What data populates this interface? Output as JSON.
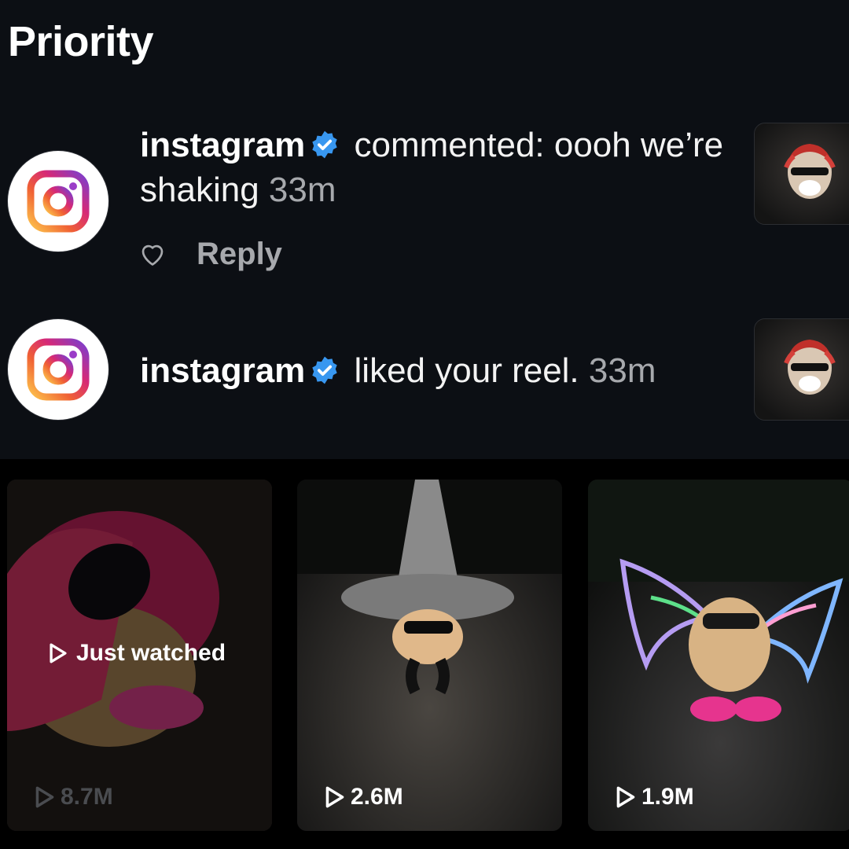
{
  "section": {
    "title": "Priority"
  },
  "notifications": [
    {
      "username": "instagram",
      "action": "commented: oooh we’re shaking",
      "time": "33m",
      "reply_label": "Reply"
    },
    {
      "username": "instagram",
      "action": "liked your reel.",
      "time": "33m"
    }
  ],
  "reels": [
    {
      "views": "8.7M",
      "status": "Just watched"
    },
    {
      "views": "2.6M"
    },
    {
      "views": "1.9M"
    }
  ],
  "icons": {
    "avatar": "instagram-logo-icon",
    "verified": "verified-badge-icon",
    "like": "heart-icon",
    "play": "play-icon"
  },
  "colors": {
    "background": "#0c0f14",
    "verified": "#3897f0",
    "muted_text": "#a7a9ad"
  }
}
